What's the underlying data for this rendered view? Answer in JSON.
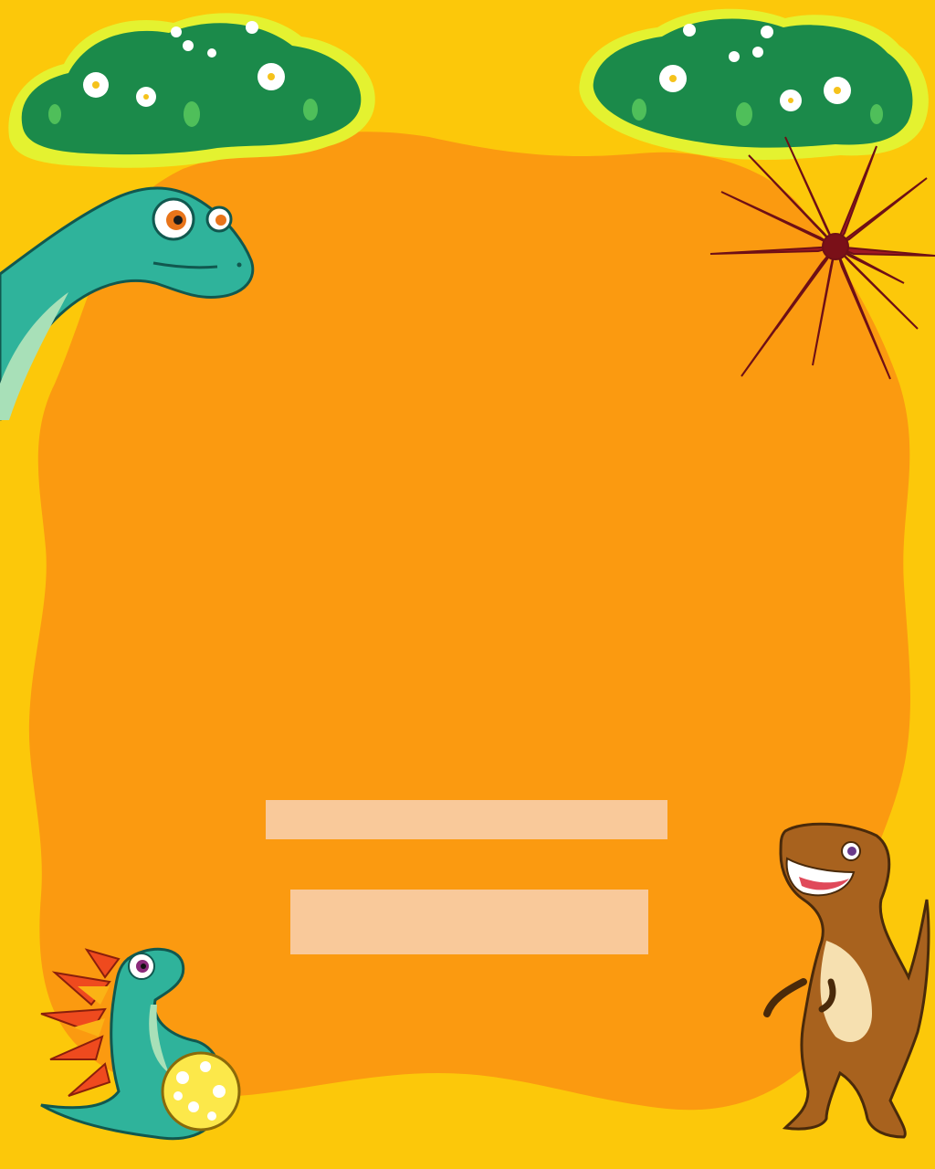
{
  "colors": {
    "background": "#fcc80a",
    "panel": "#fb9a10",
    "placeholder_bar": "#f9c99a",
    "bush_dark": "#1b8a4a",
    "bush_rim": "#e4f230",
    "flower": "#ffffff",
    "flower_center": "#f5c21b",
    "fern": "#a01a22",
    "dino_teal": "#2fb39b",
    "dino_belly": "#a8e0b8",
    "frill": "#ef4a1e",
    "egg": "#fce84a",
    "trex_brown": "#a8621e",
    "trex_belly": "#f6e0b0"
  },
  "placeholders": {
    "top_bar": "",
    "bottom_bar": ""
  },
  "illustrations": {
    "bush_left": "flowering-bush-icon",
    "bush_right": "flowering-bush-icon",
    "palm": "red-fern-palm-icon",
    "long_neck_dino": "brachiosaurus-icon",
    "frilled_dino": "frilled-dino-with-egg-icon",
    "t_rex": "t-rex-icon"
  }
}
